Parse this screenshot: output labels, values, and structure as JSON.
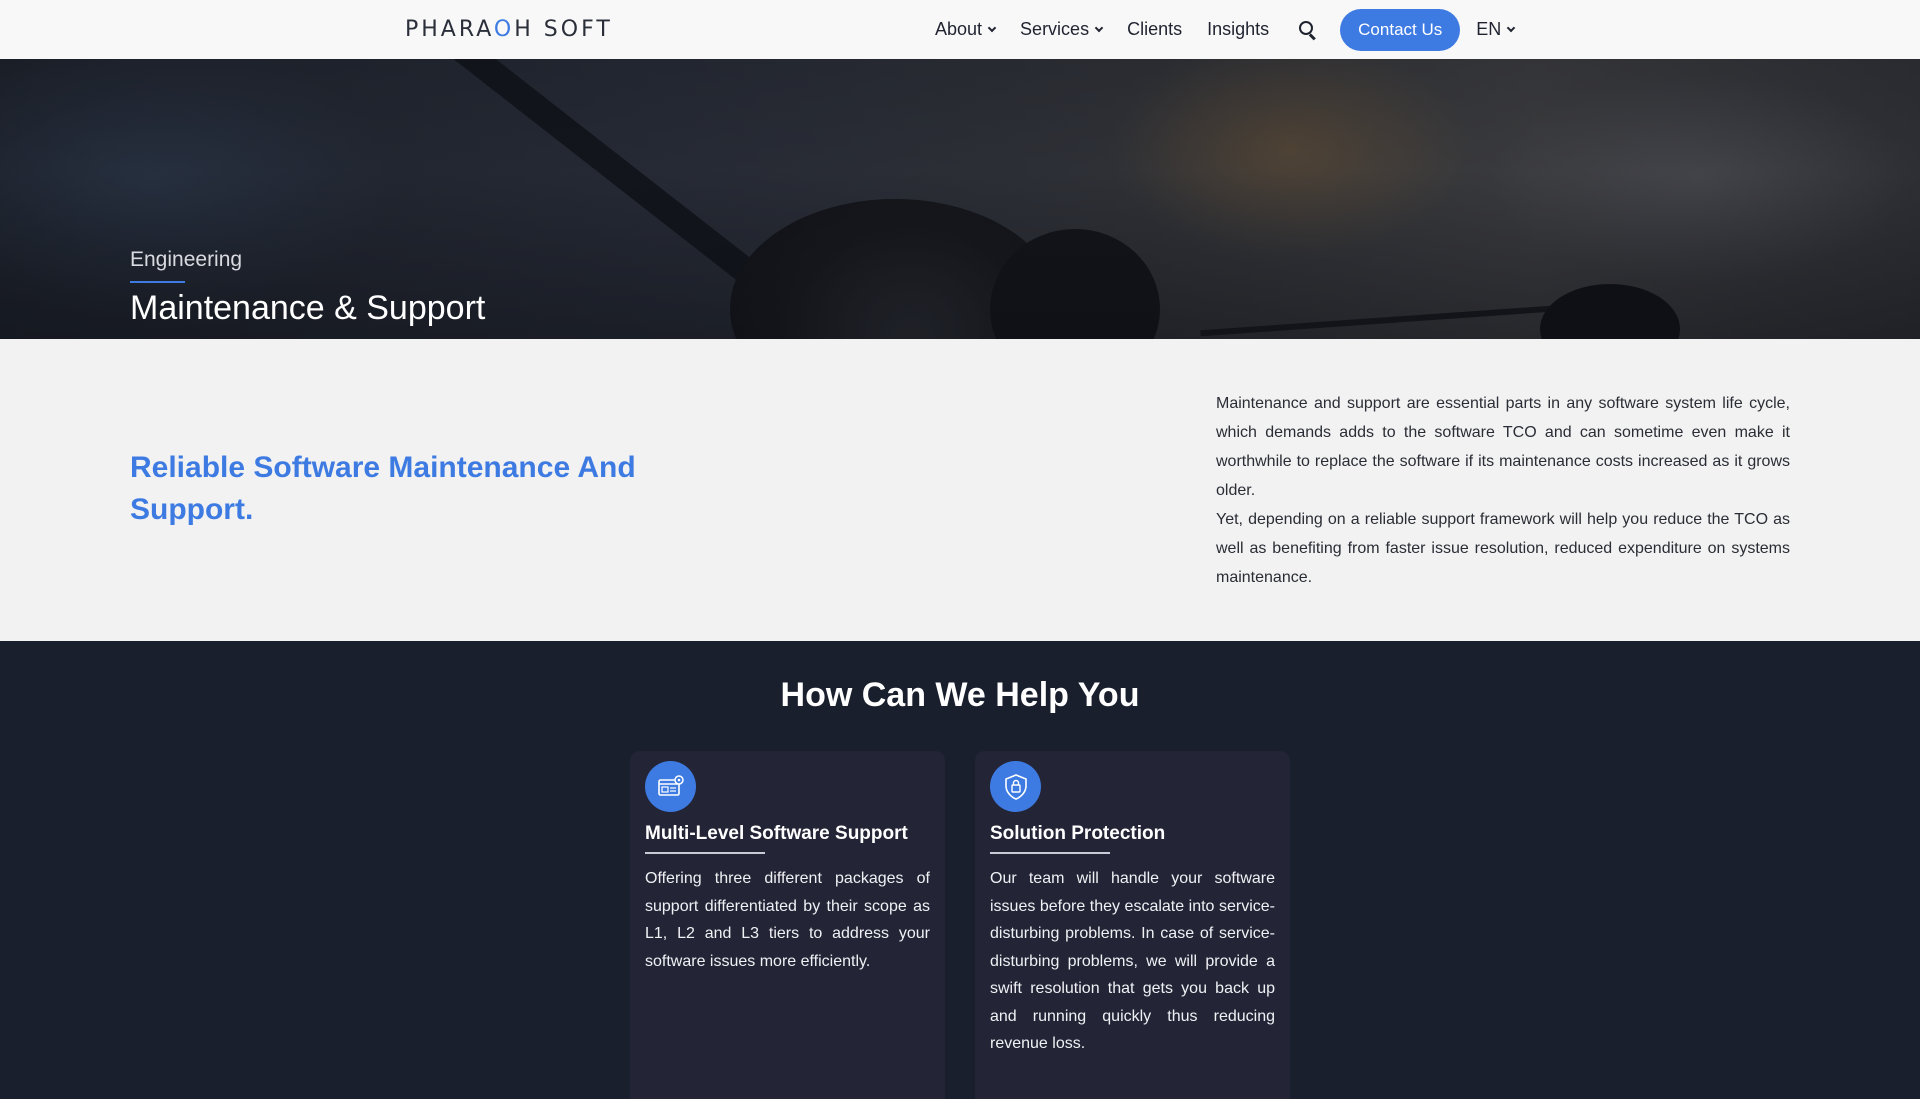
{
  "header": {
    "logo": {
      "part1": "PHARA",
      "accent": "O",
      "part2": "H SOFT"
    },
    "nav": [
      {
        "label": "About",
        "dropdown": true
      },
      {
        "label": "Services",
        "dropdown": true
      },
      {
        "label": "Clients",
        "dropdown": false
      },
      {
        "label": "Insights",
        "dropdown": false
      }
    ],
    "search_icon": "search-icon",
    "contact_label": "Contact Us",
    "language": "EN"
  },
  "hero": {
    "kicker": "Engineering",
    "title": "Maintenance & Support"
  },
  "intro": {
    "heading": "Reliable Software Maintenance And Support.",
    "paragraph1": "Maintenance and support are essential parts in any software system life cycle, which demands adds to the software TCO and can sometime even make it worthwhile to replace the software if its maintenance costs increased as it grows older.",
    "paragraph2": "Yet, depending on a reliable support framework will help you reduce the TCO as well as benefiting from faster issue resolution, reduced expenditure on systems maintenance."
  },
  "help": {
    "title": "How Can We Help You",
    "cards": [
      {
        "icon": "software-support-icon",
        "title": "Multi-Level Software Support",
        "text": "Offering three different packages of support differentiated by their scope as L1, L2 and L3 tiers to address your software issues more efficiently."
      },
      {
        "icon": "shield-lock-icon",
        "title": "Solution Protection",
        "text": "Our team will handle your software issues before they escalate into service-disturbing problems. In case of service-disturbing problems, we will provide a swift resolution that gets you back up and running quickly thus reducing revenue loss."
      }
    ]
  },
  "colors": {
    "accent": "#3d7be3",
    "dark_bg": "#1a1f2e",
    "card_bg": "#232536",
    "light_bg": "#f2f2f2"
  }
}
